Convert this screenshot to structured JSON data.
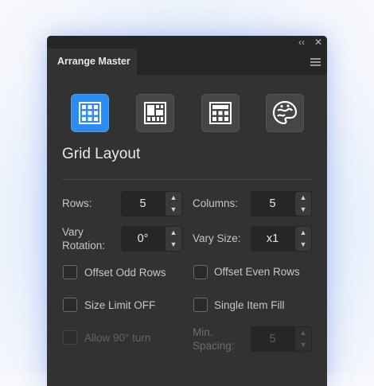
{
  "panel": {
    "title": "Arrange Master",
    "collapse_glyph": "‹‹",
    "close_glyph": "✕",
    "menu_icon": "hamburger-menu-icon"
  },
  "mode_buttons": [
    {
      "name": "grid-layout-icon",
      "active": true
    },
    {
      "name": "mosaic-layout-icon",
      "active": false
    },
    {
      "name": "split-layout-icon",
      "active": false
    },
    {
      "name": "palette-icon",
      "active": false
    }
  ],
  "section": {
    "title": "Grid Layout"
  },
  "fields": {
    "rows": {
      "label": "Rows:",
      "value": "5"
    },
    "columns": {
      "label": "Columns:",
      "value": "5"
    },
    "vary_rotation": {
      "label_line1": "Vary",
      "label_line2": "Rotation:",
      "value": "0°"
    },
    "vary_size": {
      "label": "Vary Size:",
      "value": "x1"
    },
    "min_spacing": {
      "label_line1": "Min.",
      "label_line2": "Spacing:",
      "value": "5",
      "disabled": true
    }
  },
  "checkboxes": {
    "offset_odd_rows": {
      "label": "Offset Odd Rows",
      "checked": false
    },
    "offset_even_rows": {
      "label": "Offset Even Rows",
      "checked": false
    },
    "size_limit_off": {
      "label": "Size Limit OFF",
      "checked": false
    },
    "single_item_fill": {
      "label": "Single Item Fill",
      "checked": false
    },
    "allow_90_turn": {
      "label": "Allow 90° turn",
      "checked": false,
      "disabled": true
    }
  },
  "colors": {
    "accent": "#2d8cf0",
    "panel_bg": "#323232",
    "header_bg": "#262626"
  }
}
